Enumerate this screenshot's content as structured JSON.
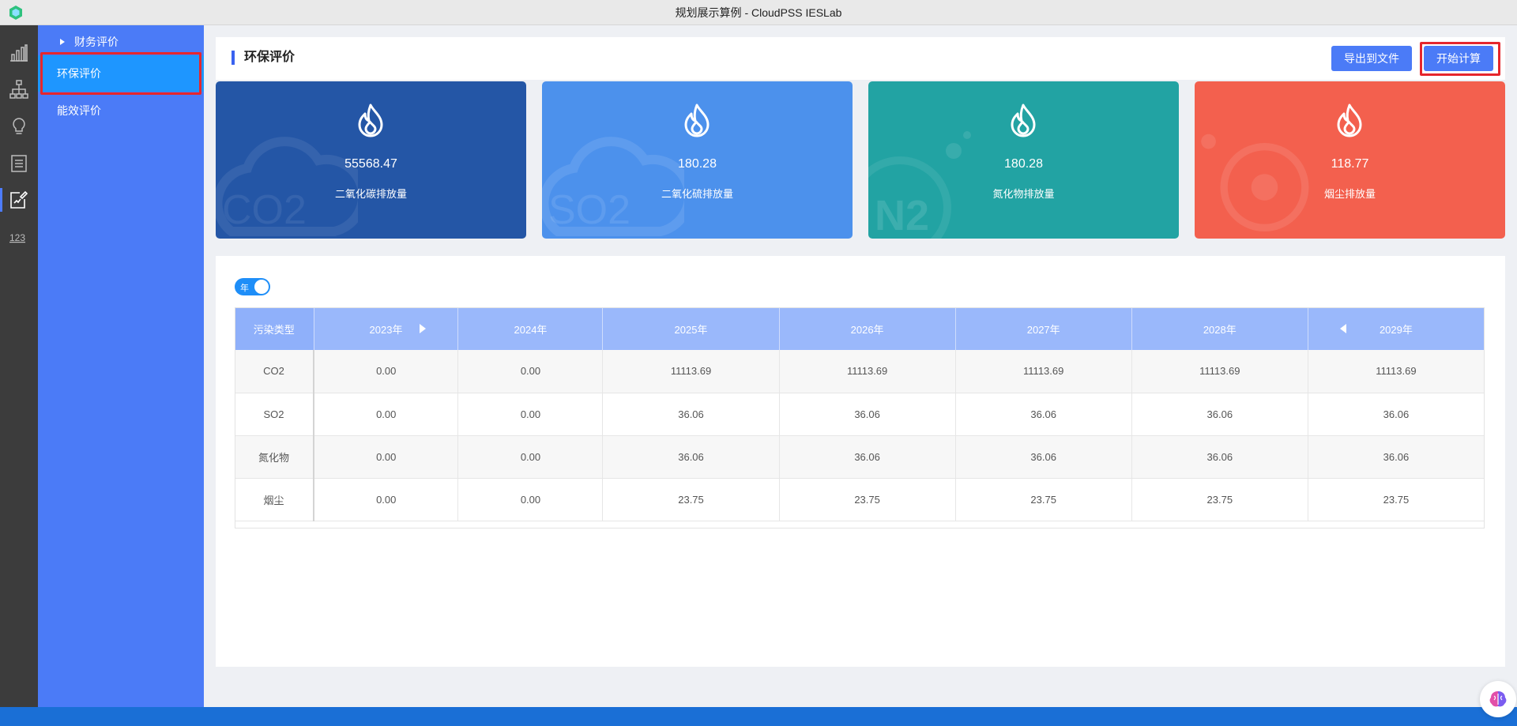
{
  "window": {
    "title": "规划展示算例 - CloudPSS IESLab"
  },
  "rail": {
    "items": [
      "chart-bars-icon",
      "hierarchy-icon",
      "lightbulb-icon",
      "list-doc-icon",
      "edit-doc-icon",
      "number-123-icon"
    ],
    "active_index": 4
  },
  "submenu": {
    "finance": "财务评价",
    "environment": "环保评价",
    "efficiency": "能效评价"
  },
  "header": {
    "title": "环保评价",
    "export_label": "导出到文件",
    "start_label": "开始计算"
  },
  "stats": [
    {
      "value": "55568.47",
      "label": "二氧化碳排放量",
      "color": "#2456a6",
      "watermark": "CO2"
    },
    {
      "value": "180.28",
      "label": "二氧化硫排放量",
      "color": "#4c91ec",
      "watermark": "SO2"
    },
    {
      "value": "180.28",
      "label": "氮化物排放量",
      "color": "#22a3a3",
      "watermark": "N2"
    },
    {
      "value": "118.77",
      "label": "烟尘排放量",
      "color": "#f3604e",
      "watermark": ""
    }
  ],
  "table": {
    "toggle_label": "年",
    "headers": [
      "污染类型",
      "2023年",
      "2024年",
      "2025年",
      "2026年",
      "2027年",
      "2028年",
      "2029年"
    ],
    "rows": [
      [
        "CO2",
        "0.00",
        "0.00",
        "11113.69",
        "11113.69",
        "11113.69",
        "11113.69",
        "11113.69"
      ],
      [
        "SO2",
        "0.00",
        "0.00",
        "36.06",
        "36.06",
        "36.06",
        "36.06",
        "36.06"
      ],
      [
        "氮化物",
        "0.00",
        "0.00",
        "36.06",
        "36.06",
        "36.06",
        "36.06",
        "36.06"
      ],
      [
        "烟尘",
        "0.00",
        "0.00",
        "23.75",
        "23.75",
        "23.75",
        "23.75",
        "23.75"
      ]
    ]
  },
  "colors": {
    "accent": "#4b7bf7",
    "highlight": "#e6262c",
    "active_submenu": "#1e96ff"
  }
}
